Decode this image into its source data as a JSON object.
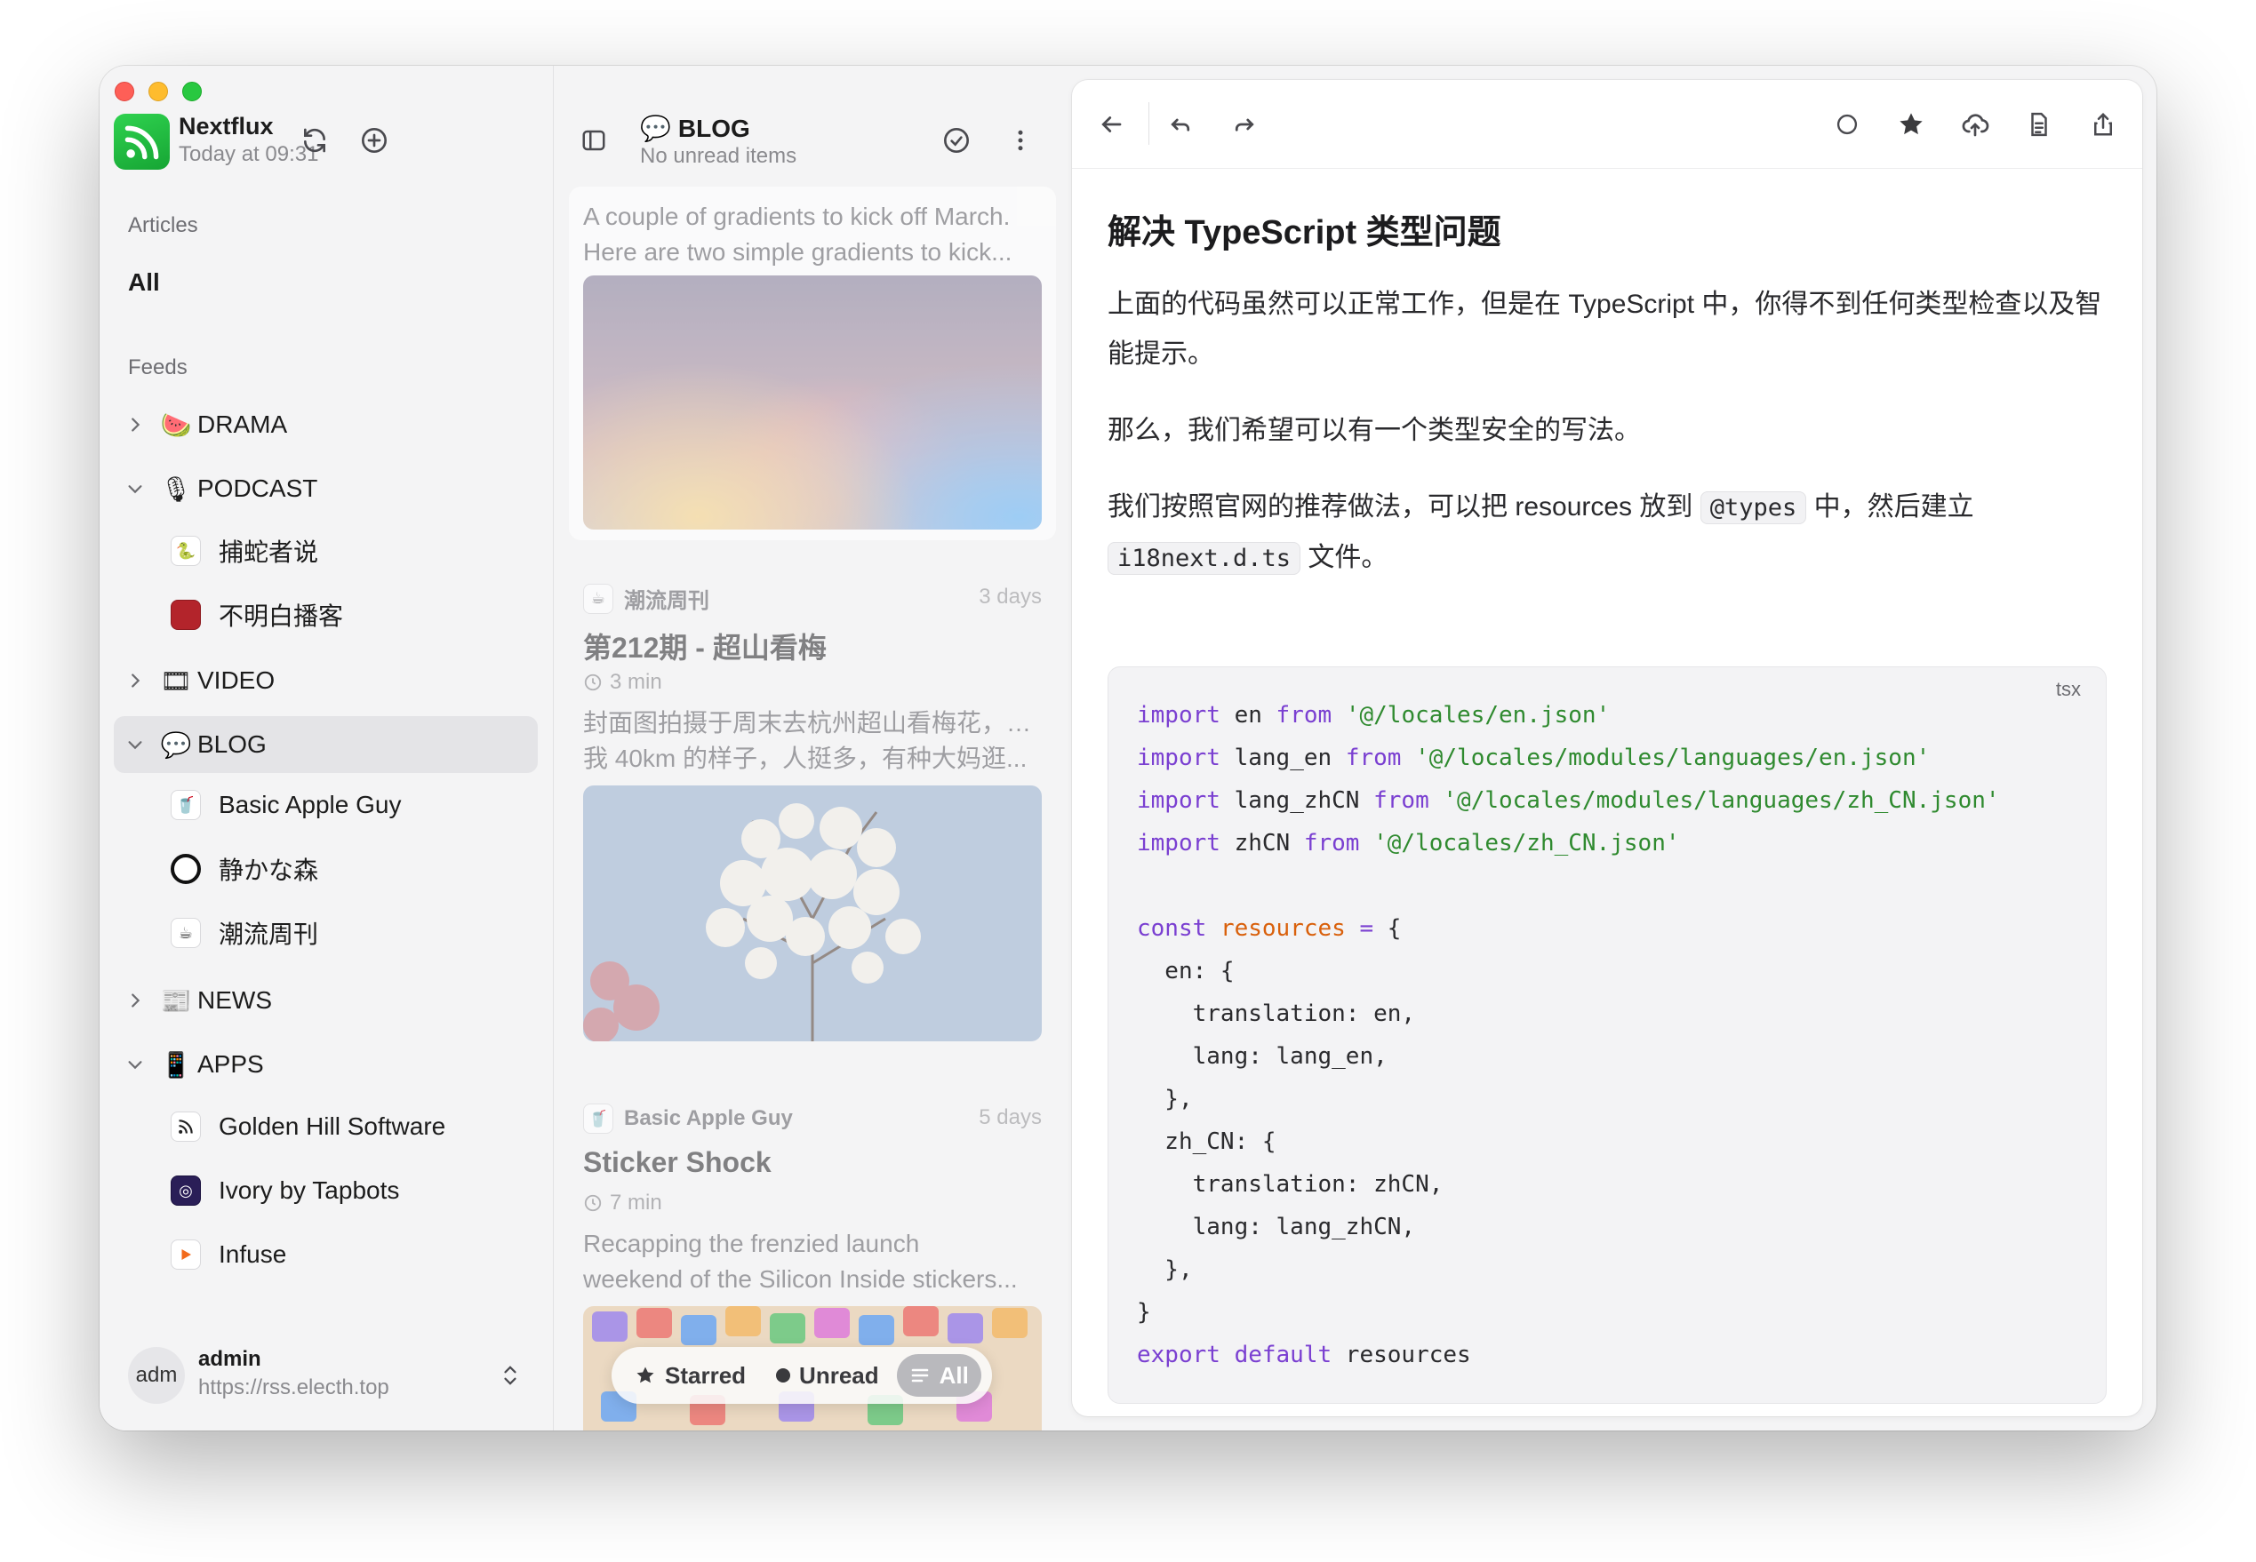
{
  "app": {
    "name": "Nextflux",
    "subtitle": "Today at 09:31"
  },
  "sidebar": {
    "articles_label": "Articles",
    "all_label": "All",
    "feeds_label": "Feeds",
    "categories": [
      {
        "emoji": "🍉",
        "label": "DRAMA",
        "expanded": false
      },
      {
        "emoji": "🎙",
        "label": "PODCAST",
        "expanded": true,
        "feeds": [
          {
            "label": "捕蛇者说",
            "icon": "snake-icon"
          },
          {
            "label": "不明白播客",
            "icon": "podcast-icon"
          }
        ]
      },
      {
        "emoji": "🎞",
        "label": "VIDEO",
        "expanded": false
      },
      {
        "emoji": "💬",
        "label": "BLOG",
        "expanded": true,
        "active": true,
        "feeds": [
          {
            "label": "Basic Apple Guy",
            "icon": "cup-icon"
          },
          {
            "label": "静かな森",
            "icon": "ring-icon"
          },
          {
            "label": "潮流周刊",
            "icon": "cup-icon"
          }
        ]
      },
      {
        "emoji": "📰",
        "label": "NEWS",
        "expanded": false
      },
      {
        "emoji": "📱",
        "label": "APPS",
        "expanded": true,
        "feeds": [
          {
            "label": "Golden Hill Software",
            "icon": "rss-icon"
          },
          {
            "label": "Ivory by Tapbots",
            "icon": "ivory-icon"
          },
          {
            "label": "Infuse",
            "icon": "play-icon"
          }
        ]
      }
    ],
    "user": {
      "avatar_text": "adm",
      "name": "admin",
      "url": "https://rss.electh.top"
    }
  },
  "list": {
    "title_emoji": "💬",
    "title": "BLOG",
    "subtitle": "No unread items",
    "articles": [
      {
        "excerpt_lines": [
          "A couple of gradients to kick off March.",
          "Here are two simple gradients to kick..."
        ]
      },
      {
        "source": "潮流周刊",
        "date": "3 days",
        "title": "第212期 - 超山看梅",
        "read_time": "3 min",
        "excerpt_lines": [
          "封面图拍摄于周末去杭州超山看梅花，距离",
          "我 40km 的样子，人挺多，有种大妈逛..."
        ]
      },
      {
        "source": "Basic Apple Guy",
        "date": "5 days",
        "title": "Sticker Shock",
        "read_time": "7 min",
        "excerpt_lines": [
          "Recapping the frenzied launch",
          "weekend of the Silicon Inside stickers..."
        ]
      }
    ],
    "filters": {
      "starred": "Starred",
      "unread": "Unread",
      "all": "All",
      "selected": "All"
    }
  },
  "reader": {
    "heading": "解决 TypeScript 类型问题",
    "para1": "上面的代码虽然可以正常工作，但是在 TypeScript 中，你得不到任何类型检查以及智能提示。",
    "para2": "那么，我们希望可以有一个类型安全的写法。",
    "para3_a": "我们按照官网的推荐做法，可以把 resources 放到",
    "para3_code1": "@types",
    "para3_b": "中，然后建立",
    "para3_code2": "i18next.d.ts",
    "para3_c": "文件。",
    "code_lang": "tsx",
    "code_lines": [
      "import en from '@/locales/en.json'",
      "import lang_en from '@/locales/modules/languages/en.json'",
      "import lang_zhCN from '@/locales/modules/languages/zh_CN.json'",
      "import zhCN from '@/locales/zh_CN.json'",
      "",
      "const resources = {",
      "  en: {",
      "    translation: en,",
      "    lang: lang_en,",
      "  },",
      "  zh_CN: {",
      "    translation: zhCN,",
      "    lang: lang_zhCN,",
      "  },",
      "}",
      "export default resources"
    ]
  },
  "colors": {
    "brand_green": "#28c840",
    "keyword": "#7a3fd1",
    "string": "#2f8a2f",
    "variable": "#d9600b"
  }
}
